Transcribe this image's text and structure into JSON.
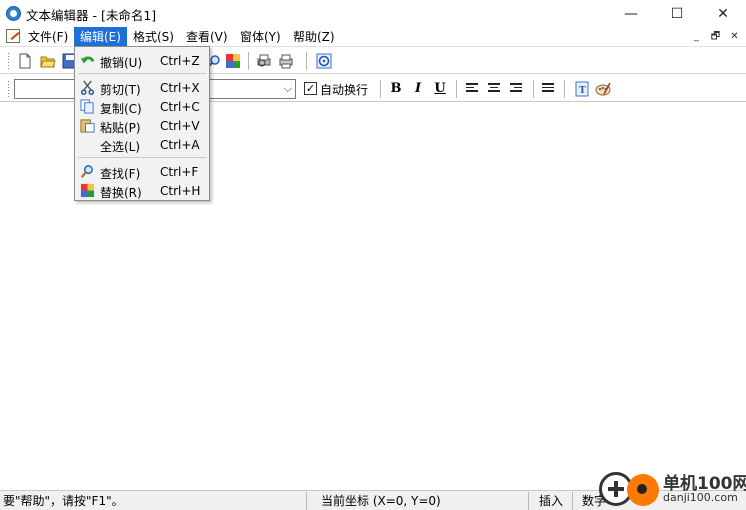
{
  "window": {
    "title": "文本编辑器 - [未命名1]",
    "controls": {
      "minimize": "—",
      "maximize": "☐",
      "close": "✕"
    }
  },
  "menubar": {
    "items": [
      {
        "label": "文件(F)"
      },
      {
        "label": "编辑(E)",
        "active": true
      },
      {
        "label": "格式(S)"
      },
      {
        "label": "查看(V)"
      },
      {
        "label": "窗体(Y)"
      },
      {
        "label": "帮助(Z)"
      }
    ],
    "mdi_controls": {
      "minimize": "_",
      "restore": "🗗",
      "close": "✕"
    }
  },
  "format_bar": {
    "font_value": "",
    "word_wrap_label": "自动换行",
    "word_wrap_checked": true,
    "bold": "B",
    "italic": "I",
    "underline": "U"
  },
  "edit_menu": {
    "items": [
      {
        "label": "撤销(U)",
        "shortcut": "Ctrl+Z",
        "icon": "undo-icon"
      },
      {
        "label": "剪切(T)",
        "shortcut": "Ctrl+X",
        "icon": "scissors-icon"
      },
      {
        "label": "复制(C)",
        "shortcut": "Ctrl+C",
        "icon": "copy-icon"
      },
      {
        "label": "粘贴(P)",
        "shortcut": "Ctrl+V",
        "icon": "paste-icon"
      },
      {
        "label": "全选(L)",
        "shortcut": "Ctrl+A",
        "icon": ""
      },
      {
        "label": "查找(F)",
        "shortcut": "Ctrl+F",
        "icon": "find-icon"
      },
      {
        "label": "替换(R)",
        "shortcut": "Ctrl+H",
        "icon": "replace-icon"
      }
    ]
  },
  "statusbar": {
    "help_text": "要\"帮助\"，请按\"F1\"。",
    "coords": "当前坐标 (X=0, Y=0)",
    "insert_mode": "插入",
    "num_lock": "数字"
  },
  "watermark": {
    "site_name": "单机100网",
    "site_url": "danji100.com"
  },
  "colors": {
    "menu_highlight": "#1e6fd6",
    "menu_bg": "#f2f2f2",
    "watermark_orange": "#ff7a00"
  }
}
